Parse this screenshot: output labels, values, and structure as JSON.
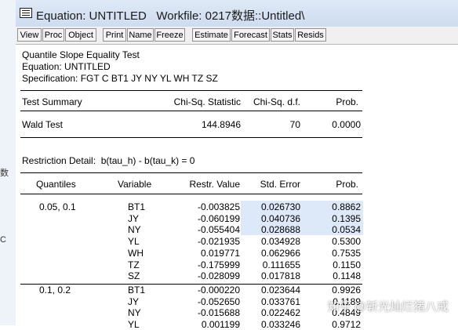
{
  "window": {
    "title": "Equation: UNTITLED   Workfile: 0217数据::Untitled\\"
  },
  "left_strip": {
    "chars": [
      "数",
      "C"
    ]
  },
  "toolbar": [
    "View",
    "Proc",
    "Object",
    "Print",
    "Name",
    "Freeze",
    "Estimate",
    "Forecast",
    "Stats",
    "Resids"
  ],
  "header": {
    "line1": "Quantile Slope Equality Test",
    "line2": "Equation: UNTITLED",
    "line3": "Specification: FGT C BT1 JY NY YL WH TZ SZ"
  },
  "summary": {
    "headers": [
      "Test Summary",
      "Chi-Sq. Statistic",
      "Chi-Sq. d.f.",
      "Prob."
    ],
    "row": {
      "label": "Wald Test",
      "stat": "144.8946",
      "df": "70",
      "prob": "0.0000"
    }
  },
  "restriction": "Restriction Detail:  b(tau_h) - b(tau_k) = 0",
  "detail": {
    "headers": [
      "Quantiles",
      "Variable",
      "Restr. Value",
      "Std. Error",
      "Prob."
    ],
    "rows": [
      {
        "q": "0.05, 0.1",
        "var": "BT1",
        "val": "-0.003825",
        "se": "0.026730",
        "p": "0.8862"
      },
      {
        "q": "",
        "var": "JY",
        "val": "-0.060199",
        "se": "0.040736",
        "p": "0.1395"
      },
      {
        "q": "",
        "var": "NY",
        "val": "-0.055404",
        "se": "0.028688",
        "p": "0.0534"
      },
      {
        "q": "",
        "var": "YL",
        "val": "-0.021935",
        "se": "0.034928",
        "p": "0.5300"
      },
      {
        "q": "",
        "var": "WH",
        "val": "0.019771",
        "se": "0.062966",
        "p": "0.7535"
      },
      {
        "q": "",
        "var": "TZ",
        "val": "-0.175999",
        "se": "0.111655",
        "p": "0.1150"
      },
      {
        "q": "",
        "var": "SZ",
        "val": "-0.028099",
        "se": "0.017818",
        "p": "0.1148"
      },
      {
        "q": "0.1, 0.2",
        "var": "BT1",
        "val": "-0.000220",
        "se": "0.023644",
        "p": "0.9926"
      },
      {
        "q": "",
        "var": "JY",
        "val": "-0.052650",
        "se": "0.033761",
        "p": "0.1189"
      },
      {
        "q": "",
        "var": "NY",
        "val": "-0.015688",
        "se": "0.022462",
        "p": "0.4849"
      },
      {
        "q": "",
        "var": "YL",
        "val": "0.001199",
        "se": "0.033246",
        "p": "0.9712"
      }
    ]
  },
  "watermark": "知乎 @斩光灿烂猪八戒"
}
